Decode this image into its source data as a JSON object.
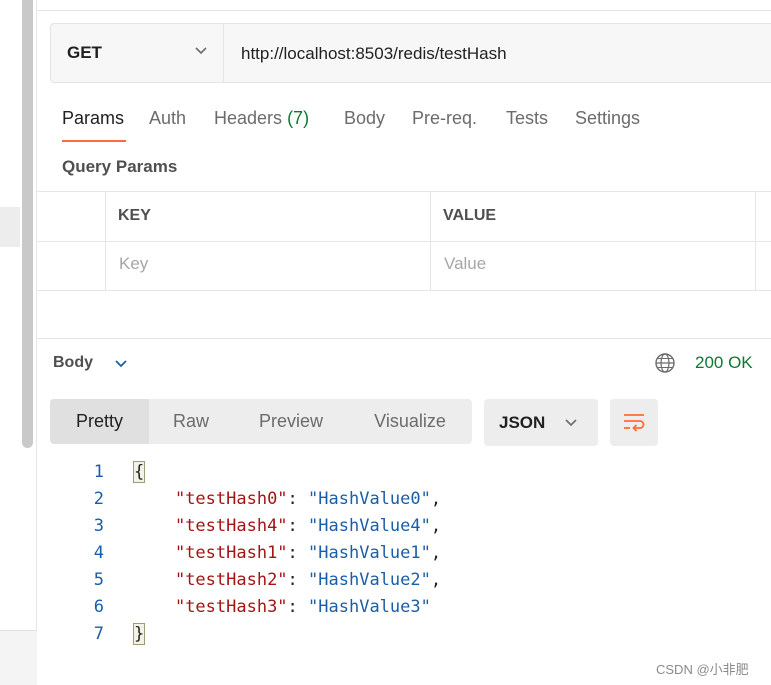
{
  "request": {
    "method": "GET",
    "url": "http://localhost:8503/redis/testHash"
  },
  "request_tabs": [
    {
      "label": "Params"
    },
    {
      "label": "Auth"
    },
    {
      "label": "Headers",
      "count": "(7)"
    },
    {
      "label": "Body"
    },
    {
      "label": "Pre-req."
    },
    {
      "label": "Tests"
    },
    {
      "label": "Settings"
    }
  ],
  "query_params": {
    "title": "Query Params",
    "col_key": "KEY",
    "col_value": "VALUE",
    "key_placeholder": "Key",
    "value_placeholder": "Value"
  },
  "response": {
    "body_label": "Body",
    "status": "200 OK",
    "view_tabs": [
      "Pretty",
      "Raw",
      "Preview",
      "Visualize"
    ],
    "format": "JSON"
  },
  "code_lines": [
    {
      "num": "1",
      "open": "{"
    },
    {
      "num": "2",
      "key": "\"testHash0\"",
      "sep": ": ",
      "value": "\"HashValue0\"",
      "tail": ","
    },
    {
      "num": "3",
      "key": "\"testHash4\"",
      "sep": ": ",
      "value": "\"HashValue4\"",
      "tail": ","
    },
    {
      "num": "4",
      "key": "\"testHash1\"",
      "sep": ": ",
      "value": "\"HashValue1\"",
      "tail": ","
    },
    {
      "num": "5",
      "key": "\"testHash2\"",
      "sep": ": ",
      "value": "\"HashValue2\"",
      "tail": ","
    },
    {
      "num": "6",
      "key": "\"testHash3\"",
      "sep": ": ",
      "value": "\"HashValue3\"",
      "tail": ""
    },
    {
      "num": "7",
      "close": "}"
    }
  ],
  "watermark": "CSDN @小非肥",
  "colors": {
    "accent": "#ff6c37",
    "success": "#0a7a35",
    "json_key": "#a31515",
    "json_value": "#1a5ea8"
  }
}
